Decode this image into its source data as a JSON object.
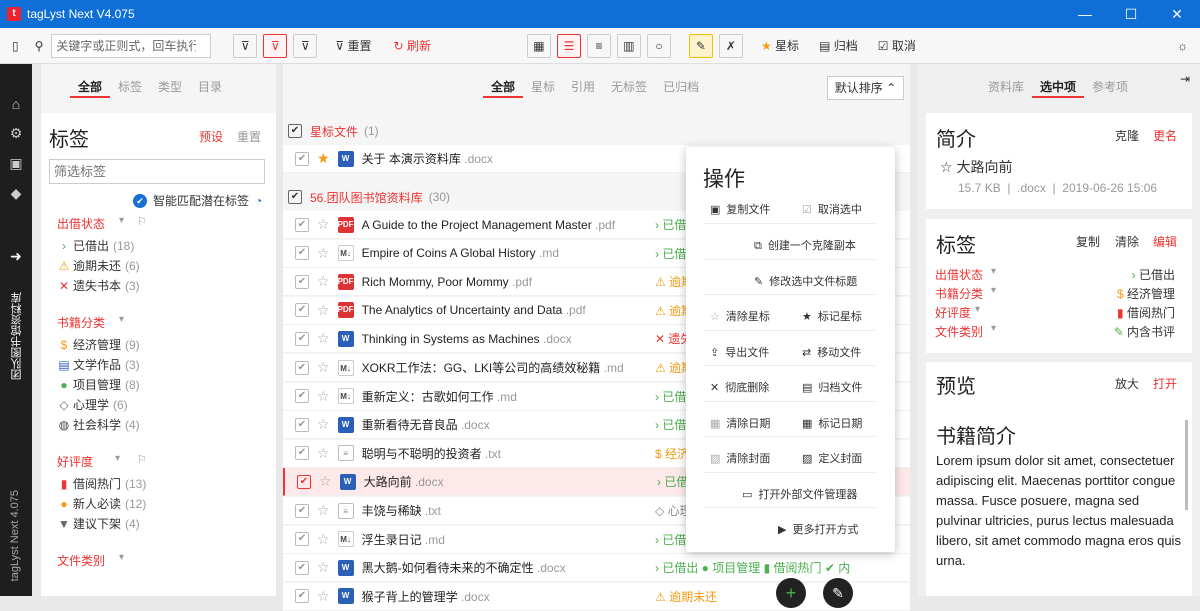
{
  "app": {
    "title": "tagLyst Next V4.075",
    "logo": "t"
  },
  "toolbar": {
    "search_placeholder": "关键字或正则式，回车执行",
    "reset": "重置",
    "refresh": "刷新",
    "star": "星标",
    "archive": "归档",
    "cancel": "取消"
  },
  "rail": {
    "vertical": "团队图书馆资料库",
    "version": "tagLyst Next 4.075"
  },
  "left": {
    "tabs": [
      "全部",
      "标签",
      "类型",
      "目录"
    ],
    "title": "标签",
    "preset": "预设",
    "reset": "重置",
    "filter_placeholder": "筛选标签",
    "smart": "智能匹配潜在标签",
    "groups": [
      {
        "name": "出借状态",
        "items": [
          {
            "icon": "›",
            "color": "#4caf50",
            "label": "已借出",
            "count": "(18)"
          },
          {
            "icon": "⚠",
            "color": "#f39c12",
            "label": "逾期未还",
            "count": "(6)"
          },
          {
            "icon": "✕",
            "color": "#e33",
            "label": "遗失书本",
            "count": "(3)"
          }
        ]
      },
      {
        "name": "书籍分类",
        "items": [
          {
            "icon": "$",
            "color": "#f39c12",
            "label": "经济管理",
            "count": "(9)"
          },
          {
            "icon": "▤",
            "color": "#2b5fb8",
            "label": "文学作品",
            "count": "(3)"
          },
          {
            "icon": "●",
            "color": "#4caf50",
            "label": "项目管理",
            "count": "(8)"
          },
          {
            "icon": "◇",
            "color": "#666",
            "label": "心理学",
            "count": "(6)"
          },
          {
            "icon": "◍",
            "color": "#444",
            "label": "社会科学",
            "count": "(4)"
          }
        ]
      },
      {
        "name": "好评度",
        "items": [
          {
            "icon": "▮",
            "color": "#e33",
            "label": "借阅热门",
            "count": "(13)"
          },
          {
            "icon": "●",
            "color": "#f39c12",
            "label": "新人必读",
            "count": "(12)"
          },
          {
            "icon": "▼",
            "color": "#666",
            "label": "建议下架",
            "count": "(4)"
          }
        ]
      },
      {
        "name": "文件类别",
        "items": []
      }
    ]
  },
  "center": {
    "tabs": [
      "全部",
      "星标",
      "引用",
      "无标签",
      "已归档"
    ],
    "sort": "默认排序",
    "group1": {
      "label": "星标文件",
      "count": "(1)"
    },
    "group2": {
      "label": "56.团队图书馆资料库",
      "count": "(30)"
    },
    "starred": {
      "name": "关于 本演示资料库",
      "ext": ".docx",
      "type": "doc"
    },
    "files": [
      {
        "name": "A Guide to the Project Management Master",
        "ext": ".pdf",
        "type": "pdf",
        "tag": "› 已借",
        "tagcolor": "#4caf50"
      },
      {
        "name": "Empire of Coins A Global History",
        "ext": ".md",
        "type": "md",
        "tag": "› 已借",
        "tagcolor": "#4caf50"
      },
      {
        "name": "Rich Mommy, Poor Mommy",
        "ext": ".pdf",
        "type": "pdf",
        "tag": "⚠ 逾期",
        "tagcolor": "#f39c12"
      },
      {
        "name": "The Analytics of Uncertainty and Data",
        "ext": ".pdf",
        "type": "pdf",
        "tag": "⚠ 逾期",
        "tagcolor": "#f39c12"
      },
      {
        "name": "Thinking in Systems as Machines",
        "ext": ".docx",
        "type": "doc",
        "tag": "✕ 遗失",
        "tagcolor": "#e33"
      },
      {
        "name": "XOKR工作法：GG、LKI等公司的高绩效秘籍",
        "ext": ".md",
        "type": "md",
        "tag": "⚠ 逾期",
        "tagcolor": "#f39c12"
      },
      {
        "name": "重新定义：古歌如何工作",
        "ext": ".md",
        "type": "md",
        "tag": "› 已借",
        "tagcolor": "#4caf50"
      },
      {
        "name": "重新看待无音良品",
        "ext": ".docx",
        "type": "doc",
        "tag": "› 已借",
        "tagcolor": "#4caf50"
      },
      {
        "name": "聪明与不聪明的投资者",
        "ext": ".txt",
        "type": "txt",
        "tag": "$ 经济",
        "tagcolor": "#f39c12"
      },
      {
        "name": "大路向前",
        "ext": ".docx",
        "type": "doc",
        "tag": "› 已借",
        "tagcolor": "#4caf50"
      },
      {
        "name": "丰饶与稀缺",
        "ext": ".txt",
        "type": "txt",
        "tag": "◇ 心理",
        "tagcolor": "#888"
      },
      {
        "name": "浮生录日记",
        "ext": ".md",
        "type": "md",
        "tag": "› 已借",
        "tagcolor": "#4caf50"
      },
      {
        "name": "黑大鹅-如何看待未来的不确定性",
        "ext": ".docx",
        "type": "doc",
        "tag": "› 已借出   ● 项目管理   ▮ 借阅热门   ✔ 内",
        "tagcolor": "#4caf50"
      },
      {
        "name": "猴子背上的管理学",
        "ext": ".docx",
        "type": "doc",
        "tag": "⚠ 逾期未还",
        "tagcolor": "#f39c12"
      }
    ]
  },
  "popup": {
    "title": "操作",
    "ops": [
      "复制文件",
      "取消选中",
      "创建一个克隆副本",
      "修改选中文件标题",
      "清除星标",
      "标记星标",
      "导出文件",
      "移动文件",
      "彻底删除",
      "归档文件",
      "清除日期",
      "标记日期",
      "清除封面",
      "定义封面",
      "打开外部文件管理器",
      "更多打开方式"
    ]
  },
  "right": {
    "tabs": [
      "资料库",
      "选中项",
      "参考项"
    ],
    "intro": {
      "title": "简介",
      "clone": "克隆",
      "rename": "更名",
      "fname": "大路向前",
      "size": "15.7 KB",
      "ext": ".docx",
      "date": "2019-06-26 15:06"
    },
    "tags": {
      "title": "标签",
      "copy": "复制",
      "clear": "清除",
      "edit": "编辑",
      "rows": [
        {
          "k": "出借状态",
          "v": "› 已借出",
          "c": "#4caf50"
        },
        {
          "k": "书籍分类",
          "v": "$ 经济管理",
          "c": "#f39c12"
        },
        {
          "k": "好评度",
          "v": "▮ 借阅热门",
          "c": "#e33"
        },
        {
          "k": "文件类别",
          "v": "✎ 内含书评",
          "c": "#4caf50"
        }
      ]
    },
    "preview": {
      "title": "预览",
      "zoom": "放大",
      "open": "打开",
      "heading": "书籍简介",
      "text": "Lorem ipsum dolor sit amet, consectetuer adipiscing elit. Maecenas porttitor congue massa. Fusce posuere, magna sed pulvinar ultricies, purus lectus malesuada libero, sit amet commodo magna eros quis urna."
    }
  }
}
